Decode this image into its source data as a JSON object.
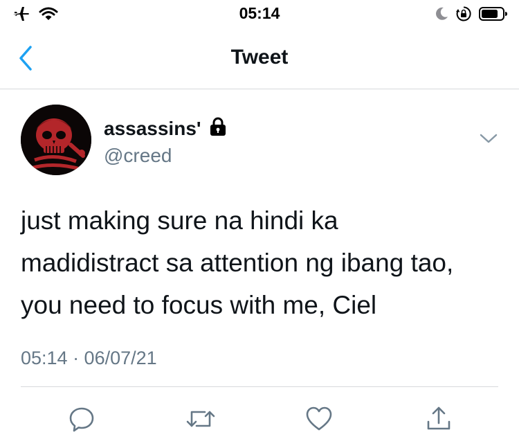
{
  "status_bar": {
    "time": "05:14",
    "icons": [
      "airplane-icon",
      "wifi-icon",
      "moon-icon",
      "orientation-lock-icon",
      "battery-icon"
    ]
  },
  "nav": {
    "title": "Tweet",
    "back_icon": "chevron-left-icon"
  },
  "tweet": {
    "display_name": "assassins'",
    "handle": "@creed",
    "protected_icon": "lock-icon",
    "text": "just making sure na hindi ka\nmadidistract sa attention ng ibang tao,\nyou need to focus with me, Ciel",
    "timestamp": "05:14 · 06/07/21"
  },
  "actions": [
    {
      "name": "reply",
      "icon": "reply-icon"
    },
    {
      "name": "retweet",
      "icon": "retweet-icon"
    },
    {
      "name": "like",
      "icon": "heart-icon"
    },
    {
      "name": "share",
      "icon": "share-icon"
    }
  ],
  "colors": {
    "accent": "#1da1f2",
    "secondary_text": "#657786",
    "action_icon": "#657786",
    "divider": "#d6d9db",
    "avatar_red": "#b3262a"
  }
}
